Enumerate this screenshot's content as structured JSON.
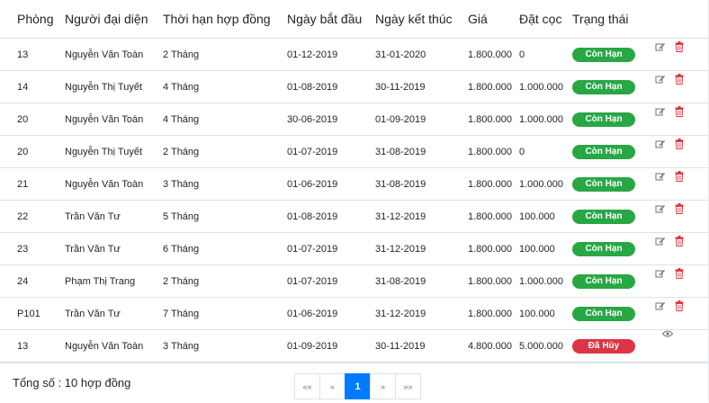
{
  "headers": [
    "Phòng",
    "Người đại diện",
    "Thời hạn hợp đồng",
    "Ngày bắt đầu",
    "Ngày kết thúc",
    "Giá",
    "Đặt cọc",
    "Trạng thái"
  ],
  "rows": [
    {
      "room": "13",
      "person": "Nguyễn Văn Toàn",
      "term": "2 Tháng",
      "start": "01-12-2019",
      "end": "31-01-2020",
      "price": "1.800.000",
      "deposit": "0",
      "status": "Còn Hạn",
      "status_type": "active"
    },
    {
      "room": "14",
      "person": "Nguyễn Thị Tuyết",
      "term": "4 Tháng",
      "start": "01-08-2019",
      "end": "30-11-2019",
      "price": "1.800.000",
      "deposit": "1.000.000",
      "status": "Còn Hạn",
      "status_type": "active"
    },
    {
      "room": "20",
      "person": "Nguyễn Văn Toàn",
      "term": "4 Tháng",
      "start": "30-06-2019",
      "end": "01-09-2019",
      "price": "1.800.000",
      "deposit": "1.000.000",
      "status": "Còn Hạn",
      "status_type": "active"
    },
    {
      "room": "20",
      "person": "Nguyễn Thị Tuyết",
      "term": "2 Tháng",
      "start": "01-07-2019",
      "end": "31-08-2019",
      "price": "1.800.000",
      "deposit": "0",
      "status": "Còn Hạn",
      "status_type": "active"
    },
    {
      "room": "21",
      "person": "Nguyễn Văn Toàn",
      "term": "3 Tháng",
      "start": "01-06-2019",
      "end": "31-08-2019",
      "price": "1.800.000",
      "deposit": "1.000.000",
      "status": "Còn Hạn",
      "status_type": "active"
    },
    {
      "room": "22",
      "person": "Trần Văn Tư",
      "term": "5 Tháng",
      "start": "01-08-2019",
      "end": "31-12-2019",
      "price": "1.800.000",
      "deposit": "100.000",
      "status": "Còn Hạn",
      "status_type": "active"
    },
    {
      "room": "23",
      "person": "Trần Văn Tư",
      "term": "6 Tháng",
      "start": "01-07-2019",
      "end": "31-12-2019",
      "price": "1.800.000",
      "deposit": "100.000",
      "status": "Còn Hạn",
      "status_type": "active"
    },
    {
      "room": "24",
      "person": "Phạm Thị Trang",
      "term": "2 Tháng",
      "start": "01-07-2019",
      "end": "31-08-2019",
      "price": "1.800.000",
      "deposit": "1.000.000",
      "status": "Còn Hạn",
      "status_type": "active"
    },
    {
      "room": "P101",
      "person": "Trần Văn Tư",
      "term": "7 Tháng",
      "start": "01-06-2019",
      "end": "31-12-2019",
      "price": "1.800.000",
      "deposit": "100.000",
      "status": "Còn Hạn",
      "status_type": "active"
    },
    {
      "room": "13",
      "person": "Nguyễn Văn Toàn",
      "term": "3 Tháng",
      "start": "01-09-2019",
      "end": "30-11-2019",
      "price": "4.800.000",
      "deposit": "5.000.000",
      "status": "Đã Hủy",
      "status_type": "cancelled"
    }
  ],
  "colors": {
    "active": "#28a745",
    "cancelled": "#dc3545",
    "edit_icon": "#6c757d",
    "delete_icon": "#dc3545",
    "primary": "#007bff"
  },
  "icons": {
    "edit": "edit-icon",
    "delete": "trash-icon",
    "view": "eye-icon"
  },
  "footer": {
    "total": "Tổng số : 10 hợp đồng"
  },
  "pagination": {
    "first": "««",
    "prev": "«",
    "current": "1",
    "next": "»",
    "last": "»»"
  }
}
